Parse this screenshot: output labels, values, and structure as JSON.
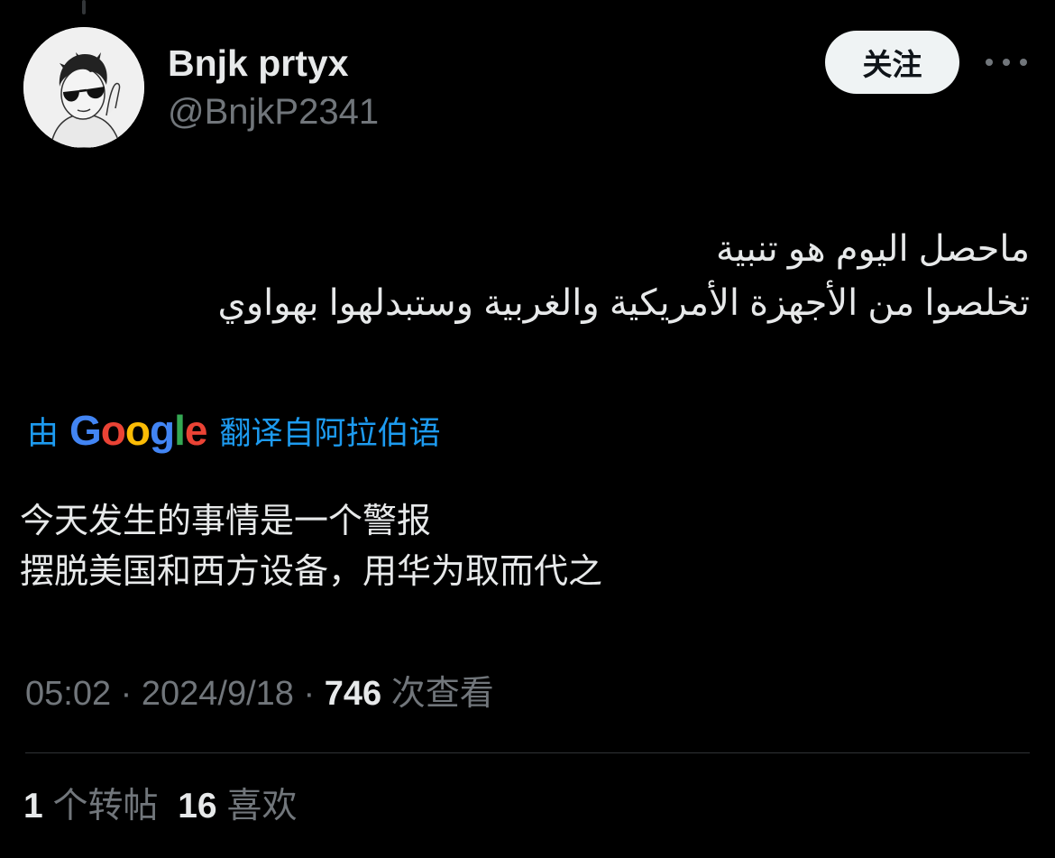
{
  "author": {
    "display_name": "Bnjk prtyx",
    "handle": "@BnjkP2341"
  },
  "follow_label": "关注",
  "tweet": {
    "arabic_lines": [
      "ماحصل اليوم هو تنبية",
      "تخلصوا من الأجهزة الأمريكية والغربية وستبدلهوا بهواوي"
    ],
    "translation": {
      "prefix": "由",
      "provider_logo_letters": [
        "G",
        "o",
        "o",
        "g",
        "l",
        "e"
      ],
      "provider_logo_colors": [
        "#4285F4",
        "#EA4335",
        "#FBBC05",
        "#4285F4",
        "#34A853",
        "#EA4335"
      ],
      "suffix": "翻译自阿拉伯语"
    },
    "translated_lines": [
      "今天发生的事情是一个警报",
      "摆脱美国和西方设备，用华为取而代之"
    ]
  },
  "meta": {
    "time": "05:02",
    "date": "2024/9/18",
    "separator": " · ",
    "views_count": "746",
    "views_label": "次查看"
  },
  "stats": {
    "reposts_count": "1",
    "reposts_label": "个转帖",
    "likes_count": "16",
    "likes_label": "喜欢"
  },
  "colors": {
    "background": "#000000",
    "primary_text": "#e7e9ea",
    "secondary_text": "#71767b",
    "link_blue": "#1d9bf0",
    "follow_button_bg": "#eff3f4"
  }
}
